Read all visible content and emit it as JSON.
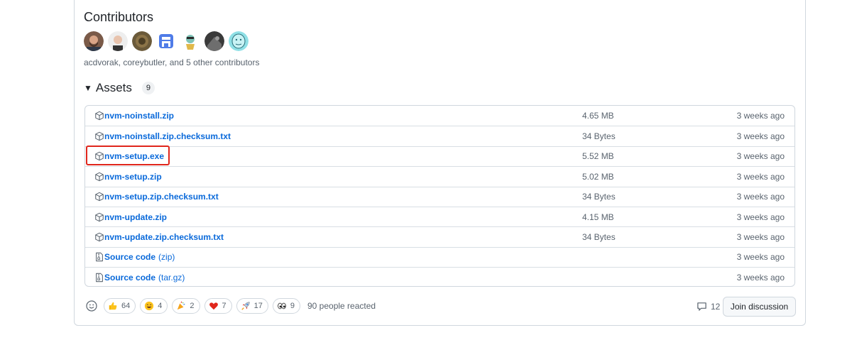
{
  "contributors": {
    "title": "Contributors",
    "avatars": [
      "acdvorak",
      "coreybutler",
      "contributor-3",
      "contributor-4",
      "contributor-5",
      "contributor-6",
      "contributor-7"
    ],
    "summary": "acdvorak, coreybutler, and 5 other contributors"
  },
  "assets": {
    "title": "Assets",
    "count": "9",
    "items": [
      {
        "name": "nvm-noinstall.zip",
        "size": "4.65 MB",
        "date": "3 weeks ago",
        "icon": "package-icon"
      },
      {
        "name": "nvm-noinstall.zip.checksum.txt",
        "size": "34 Bytes",
        "date": "3 weeks ago",
        "icon": "package-icon"
      },
      {
        "name": "nvm-setup.exe",
        "size": "5.52 MB",
        "date": "3 weeks ago",
        "icon": "package-icon"
      },
      {
        "name": "nvm-setup.zip",
        "size": "5.02 MB",
        "date": "3 weeks ago",
        "icon": "package-icon"
      },
      {
        "name": "nvm-setup.zip.checksum.txt",
        "size": "34 Bytes",
        "date": "3 weeks ago",
        "icon": "package-icon"
      },
      {
        "name": "nvm-update.zip",
        "size": "4.15 MB",
        "date": "3 weeks ago",
        "icon": "package-icon"
      },
      {
        "name": "nvm-update.zip.checksum.txt",
        "size": "34 Bytes",
        "date": "3 weeks ago",
        "icon": "package-icon"
      },
      {
        "name": "Source code",
        "ext": "(zip)",
        "size": "",
        "date": "3 weeks ago",
        "icon": "file-zip-icon"
      },
      {
        "name": "Source code",
        "ext": "(tar.gz)",
        "size": "",
        "date": "3 weeks ago",
        "icon": "file-zip-icon"
      }
    ]
  },
  "reactions": {
    "items": [
      {
        "emoji": "thumbs-up",
        "count": "64"
      },
      {
        "emoji": "laugh",
        "count": "4"
      },
      {
        "emoji": "hooray",
        "count": "2"
      },
      {
        "emoji": "heart",
        "count": "7"
      },
      {
        "emoji": "rocket",
        "count": "17"
      },
      {
        "emoji": "eyes",
        "count": "9"
      }
    ],
    "summary": "90 people reacted"
  },
  "discussion": {
    "comment_count": "12",
    "join_label": "Join discussion"
  },
  "colors": {
    "link": "#0969da",
    "muted": "#59636e",
    "highlight": "#e0261c",
    "border": "#d0d7de"
  }
}
